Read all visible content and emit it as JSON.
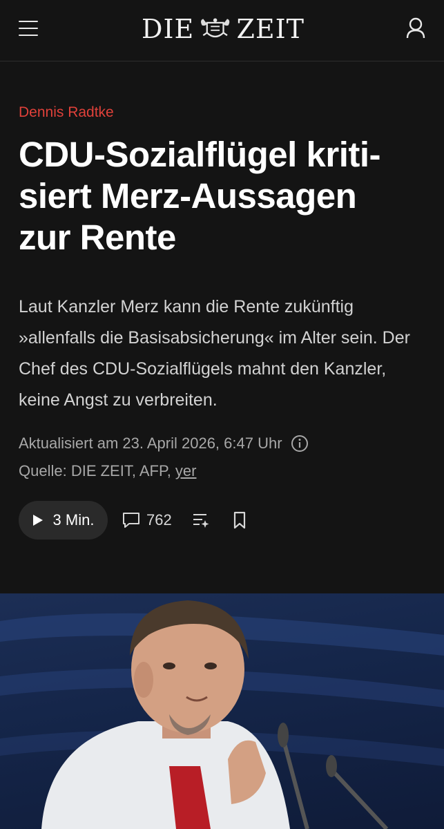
{
  "header": {
    "menu_icon": "hamburger-menu-icon",
    "logo_text_left": "DIE",
    "logo_text_right": "ZEIT",
    "account_icon": "user-icon"
  },
  "article": {
    "author": "Dennis Radtke",
    "headline": "CDU-Sozialflügel kriti-\nsiert Merz-Aussagen\nzur Rente",
    "teaser": "Laut Kanzler Merz kann die Rente zukünftig »allenfalls die Basisabsicherung« im Alter sein. Der Chef des CDU-Sozialflügels mahnt den Kanzler, keine Angst zu verbreiten.",
    "updated": "Aktualisiert am 23. April 2026, 6:47 Uhr",
    "source_prefix": "Quelle: DIE ZEIT, AFP,",
    "source_author": "yer"
  },
  "actions": {
    "audio_label": "3 Min.",
    "comment_count": "762",
    "summary_icon": "ai-summary-icon",
    "bookmark_icon": "bookmark-icon"
  },
  "colors": {
    "background": "#141414",
    "author_accent": "#e0413a",
    "button_bg": "#2a2a2a"
  }
}
